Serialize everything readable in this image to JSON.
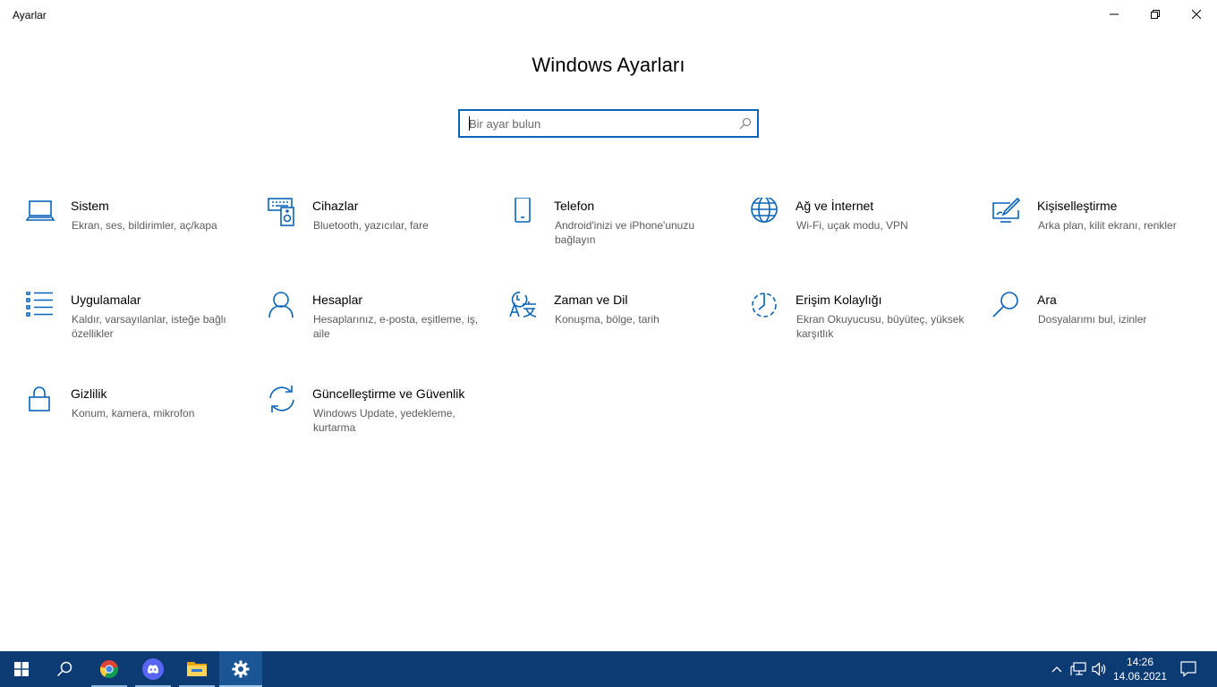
{
  "window": {
    "title": "Ayarlar"
  },
  "page": {
    "title": "Windows Ayarları"
  },
  "search": {
    "placeholder": "Bir ayar bulun",
    "value": ""
  },
  "tiles": [
    {
      "title": "Sistem",
      "desc": "Ekran, ses, bildirimler, aç/kapa",
      "icon": "laptop-icon"
    },
    {
      "title": "Cihazlar",
      "desc": "Bluetooth, yazıcılar, fare",
      "icon": "devices-icon"
    },
    {
      "title": "Telefon",
      "desc": "Android'inizi ve iPhone'unuzu bağlayın",
      "icon": "phone-icon"
    },
    {
      "title": "Ağ ve İnternet",
      "desc": "Wi-Fi, uçak modu, VPN",
      "icon": "globe-icon"
    },
    {
      "title": "Kişiselleştirme",
      "desc": "Arka plan, kilit ekranı, renkler",
      "icon": "paint-icon"
    },
    {
      "title": "Uygulamalar",
      "desc": "Kaldır, varsayılanlar, isteğe bağlı özellikler",
      "icon": "apps-list-icon"
    },
    {
      "title": "Hesaplar",
      "desc": "Hesaplarınız, e-posta, eşitleme, iş, aile",
      "icon": "person-icon"
    },
    {
      "title": "Zaman ve Dil",
      "desc": "Konuşma, bölge, tarih",
      "icon": "time-language-icon"
    },
    {
      "title": "Erişim Kolaylığı",
      "desc": "Ekran Okuyucusu, büyüteç, yüksek karşıtlık",
      "icon": "ease-of-access-icon"
    },
    {
      "title": "Ara",
      "desc": "Dosyalarımı bul, izinler",
      "icon": "search-icon"
    },
    {
      "title": "Gizlilik",
      "desc": "Konum, kamera, mikrofon",
      "icon": "lock-icon"
    },
    {
      "title": "Güncelleştirme ve Güvenlik",
      "desc": "Windows Update, yedekleme, kurtarma",
      "icon": "sync-icon"
    }
  ],
  "taskbar": {
    "items": [
      "windows-start-icon",
      "search-icon",
      "chrome-icon",
      "discord-icon",
      "file-explorer-icon",
      "settings-gear-icon"
    ],
    "clock": {
      "time": "14:26",
      "date": "14.06.2021"
    }
  },
  "colors": {
    "accent": "#0a64b8",
    "taskbar": "#0c3a73",
    "taskbar_active": "#1a5595"
  }
}
